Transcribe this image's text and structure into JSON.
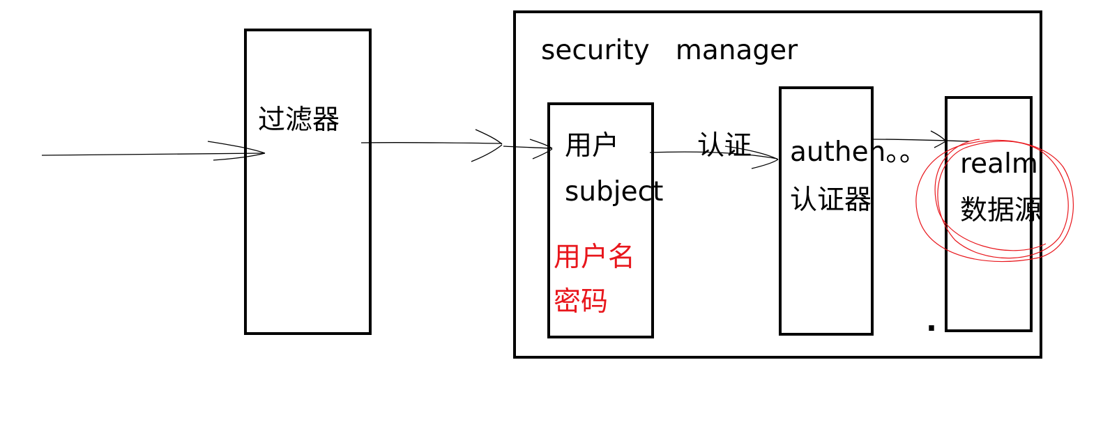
{
  "diagram": {
    "filter_label": "过滤器",
    "security_manager_label": "security   manager",
    "subject_box": {
      "line1": "用户",
      "line2": "subject",
      "credentials_line1": "用户名",
      "credentials_line2": "密码"
    },
    "auth_edge_label": "认证",
    "authenticator_box": {
      "line1": "authen。。",
      "line2": "认证器"
    },
    "realm_box": {
      "line1": "realm",
      "line2": "数据源"
    },
    "dot": "."
  },
  "colors": {
    "stroke": "#000000",
    "highlight_text": "#e8161c",
    "circle": "#e8161c"
  }
}
